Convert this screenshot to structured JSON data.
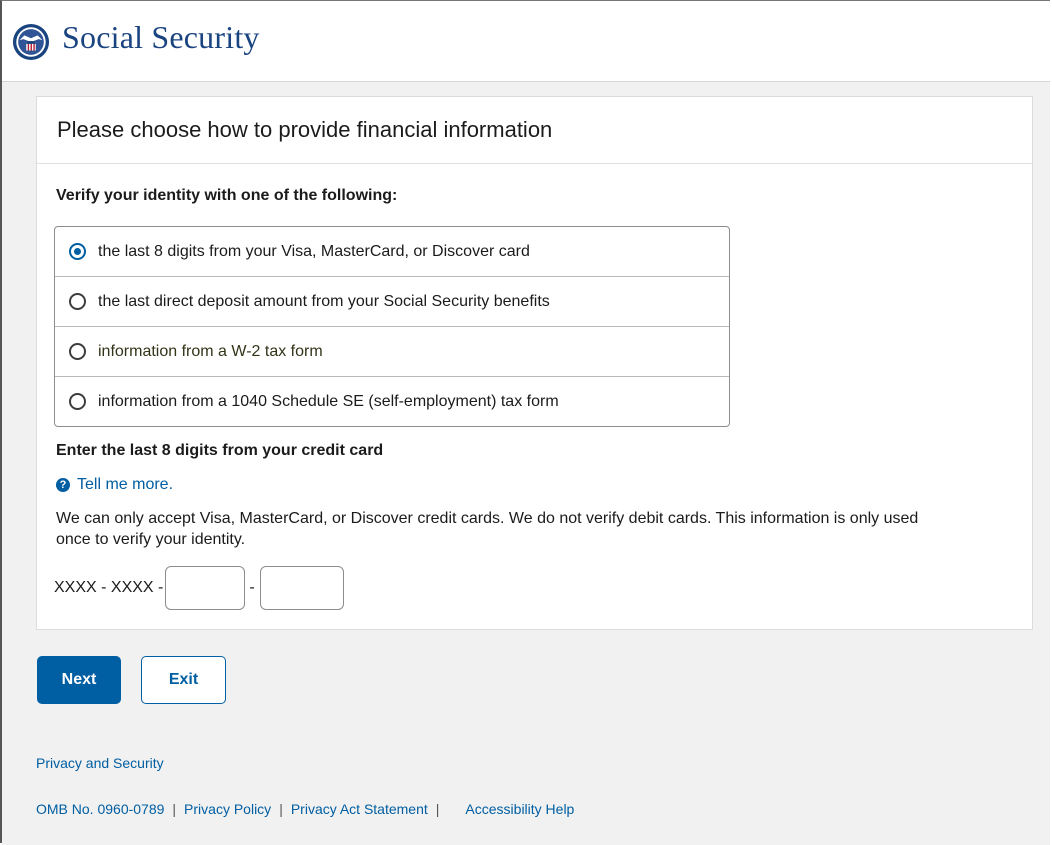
{
  "header": {
    "brand": "Social Security"
  },
  "card": {
    "title": "Please choose how to provide financial information",
    "subtitle": "Verify your identity with one of the following:",
    "options": [
      {
        "label": "the last 8 digits from your Visa, MasterCard, or Discover card",
        "selected": true
      },
      {
        "label": "the last direct deposit amount from your Social Security benefits",
        "selected": false
      },
      {
        "label": "information from a W-2 tax form",
        "selected": false
      },
      {
        "label": "information from a 1040 Schedule SE (self-employment) tax form",
        "selected": false
      }
    ],
    "cc_title": "Enter the last 8 digits from your credit card",
    "help_icon": "?",
    "tell_me_more": "Tell me more.",
    "info": "We can only accept Visa, MasterCard, or Discover credit cards.  We do not verify debit cards.  This information is only used once to verify your identity.",
    "cc_prefix": "XXXX - XXXX -",
    "cc_separator": "-",
    "cc_field_1": "",
    "cc_field_2": ""
  },
  "buttons": {
    "next": "Next",
    "exit": "Exit"
  },
  "footer": {
    "privacy_security": "Privacy and Security",
    "omb": "OMB No. 0960-0789",
    "sep": "|",
    "privacy_policy": "Privacy Policy",
    "privacy_act": "Privacy Act Statement",
    "accessibility": "Accessibility Help"
  },
  "colors": {
    "primary": "#005ea2",
    "brand": "#1a4480",
    "background": "#f1f1f1"
  }
}
